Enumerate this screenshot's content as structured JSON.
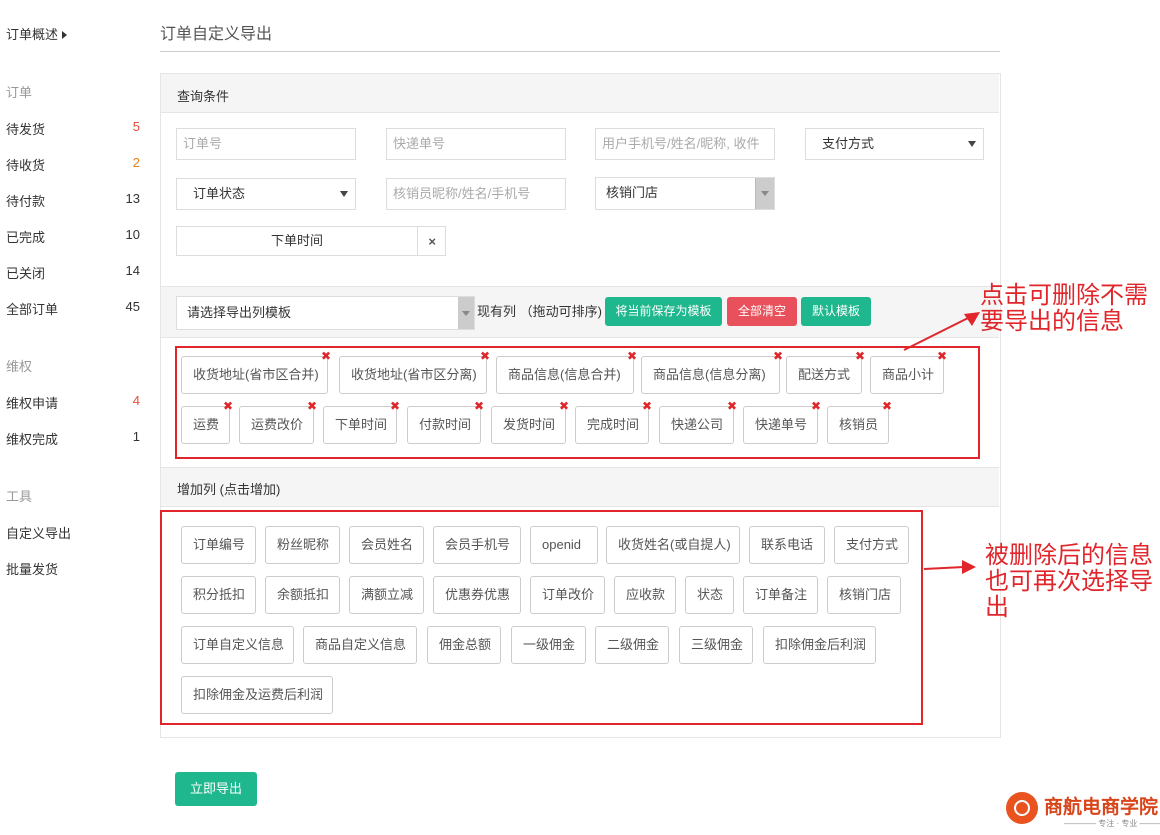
{
  "sidebar": {
    "overview": "订单概述",
    "group_orders": "订单",
    "orders": [
      {
        "label": "待发货",
        "count": "5"
      },
      {
        "label": "待收货",
        "count": "2"
      },
      {
        "label": "待付款",
        "count": "13"
      },
      {
        "label": "已完成",
        "count": "10"
      },
      {
        "label": "已关闭",
        "count": "14"
      },
      {
        "label": "全部订单",
        "count": "45"
      }
    ],
    "group_rights": "维权",
    "rights": [
      {
        "label": "维权申请",
        "count": "4"
      },
      {
        "label": "维权完成",
        "count": "1"
      }
    ],
    "group_tools": "工具",
    "tools": [
      "自定义导出",
      "批量发货"
    ]
  },
  "page_title": "订单自定义导出",
  "query": {
    "title": "查询条件",
    "order_no_placeholder": "订单号",
    "express_no_placeholder": "快递单号",
    "user_placeholder": "用户手机号/姓名/昵称, 收件",
    "pay_method": "支付方式",
    "order_status": "订单状态",
    "verifier_placeholder": "核销员昵称/姓名/手机号",
    "store": "核销门店",
    "order_time": "下单时间",
    "clear_icon": "×"
  },
  "template": {
    "select_label": "请选择导出列模板",
    "hint": "现有列 （拖动可排序)",
    "save_btn": "将当前保存为模板",
    "clear_btn": "全部清空",
    "default_btn": "默认模板"
  },
  "current_columns": [
    "收货地址(省市区合并)",
    "收货地址(省市区分离)",
    "商品信息(信息合并)",
    "商品信息(信息分离)",
    "配送方式",
    "商品小计",
    "运费",
    "运费改价",
    "下单时间",
    "付款时间",
    "发货时间",
    "完成时间",
    "快递公司",
    "快递单号",
    "核销员"
  ],
  "remove_mark": "✖",
  "add_section": {
    "title": "增加列 (点击增加)",
    "columns": [
      "订单编号",
      "粉丝昵称",
      "会员姓名",
      "会员手机号",
      "openid",
      "收货姓名(或自提人)",
      "联系电话",
      "支付方式",
      "积分抵扣",
      "余额抵扣",
      "满额立减",
      "优惠券优惠",
      "订单改价",
      "应收款",
      "状态",
      "订单备注",
      "核销门店",
      "订单自定义信息",
      "商品自定义信息",
      "佣金总额",
      "一级佣金",
      "二级佣金",
      "三级佣金",
      "扣除佣金后利润",
      "扣除佣金及运费后利润"
    ]
  },
  "export_btn": "立即导出",
  "annotations": {
    "top": "点击可删除不需要导出的信息",
    "bottom": "被删除后的信息也可再次选择导出"
  },
  "logo": {
    "name": "商航电商学院",
    "slogan": "———— 专注 · 专业 ————"
  },
  "colors": {
    "accent": "#1fb88e",
    "danger": "#e8505b",
    "annotation": "#e0262b"
  }
}
